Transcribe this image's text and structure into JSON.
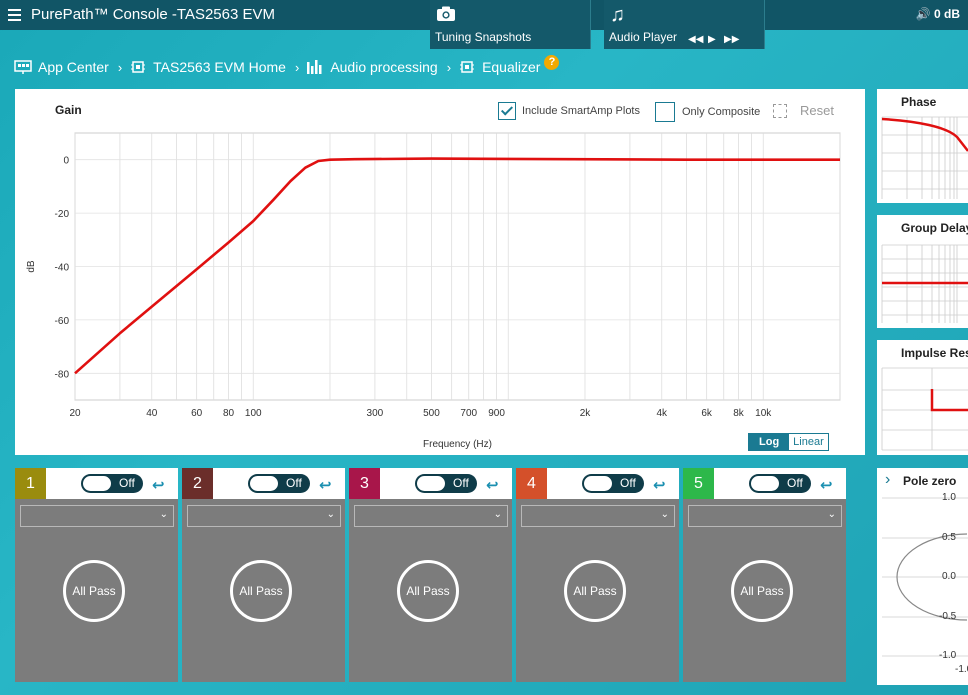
{
  "app": {
    "title": "PurePath™ Console -TAS2563 EVM",
    "volume": "0 dB"
  },
  "toolbar": {
    "snapshots_label": "Tuning Snapshots",
    "audio_player_label": "Audio Player"
  },
  "breadcrumb": [
    {
      "label": "App Center"
    },
    {
      "label": "TAS2563 EVM Home"
    },
    {
      "label": "Audio processing"
    },
    {
      "label": "Equalizer"
    }
  ],
  "gain_panel": {
    "include_smartamp_label": "Include SmartAmp Plots",
    "include_smartamp_checked": true,
    "only_composite_label": "Only Composite",
    "only_composite_checked": false,
    "reset_label": "Reset",
    "scale_log": "Log",
    "scale_linear": "Linear",
    "scale_active": "Log"
  },
  "chart_data": {
    "type": "line",
    "title": "Gain",
    "xlabel": "Frequency (Hz)",
    "ylabel": "dB",
    "xscale": "log",
    "xlim": [
      20,
      20000
    ],
    "ylim": [
      -90,
      10
    ],
    "xticks": [
      20,
      40,
      60,
      80,
      100,
      300,
      500,
      700,
      900,
      2000,
      4000,
      6000,
      8000,
      10000
    ],
    "xtick_labels": [
      "20",
      "40",
      "60",
      "80",
      "100",
      "300",
      "500",
      "700",
      "900",
      "2k",
      "4k",
      "6k",
      "8k",
      "10k"
    ],
    "yticks": [
      0,
      -20,
      -40,
      -60,
      -80
    ],
    "ytick_labels": [
      "0",
      "-20",
      "-40",
      "-60",
      "-80"
    ],
    "series": [
      {
        "color": "#e01010",
        "x": [
          20,
          30,
          40,
          60,
          80,
          100,
          120,
          140,
          160,
          180,
          200,
          250,
          500,
          1000,
          5000,
          20000
        ],
        "y": [
          -80,
          -65,
          -55,
          -41,
          -31,
          -23,
          -15,
          -8,
          -3,
          -0.5,
          0,
          0.2,
          0.4,
          0.3,
          0,
          0
        ]
      }
    ],
    "grid": true,
    "line_color": "#e01010"
  },
  "side_panels": [
    {
      "title": "Phase"
    },
    {
      "title": "Group Delay"
    },
    {
      "title": "Impulse Response"
    }
  ],
  "pole_zero": {
    "title": "Pole zero",
    "ticks": [
      "1.0",
      "0.5",
      "0.0",
      "-0.5",
      "-1.0"
    ]
  },
  "bands": [
    {
      "number": "1",
      "color": "#9a8c0e",
      "toggle": "Off",
      "filter": "All Pass"
    },
    {
      "number": "2",
      "color": "#6b2e2a",
      "toggle": "Off",
      "filter": "All Pass"
    },
    {
      "number": "3",
      "color": "#a8164a",
      "toggle": "Off",
      "filter": "All Pass"
    },
    {
      "number": "4",
      "color": "#d4502a",
      "toggle": "Off",
      "filter": "All Pass"
    },
    {
      "number": "5",
      "color": "#2db84a",
      "toggle": "Off",
      "filter": "All Pass"
    }
  ],
  "colors": {
    "topbar": "#115566",
    "accent": "#1a7a92",
    "curve": "#e01010"
  }
}
